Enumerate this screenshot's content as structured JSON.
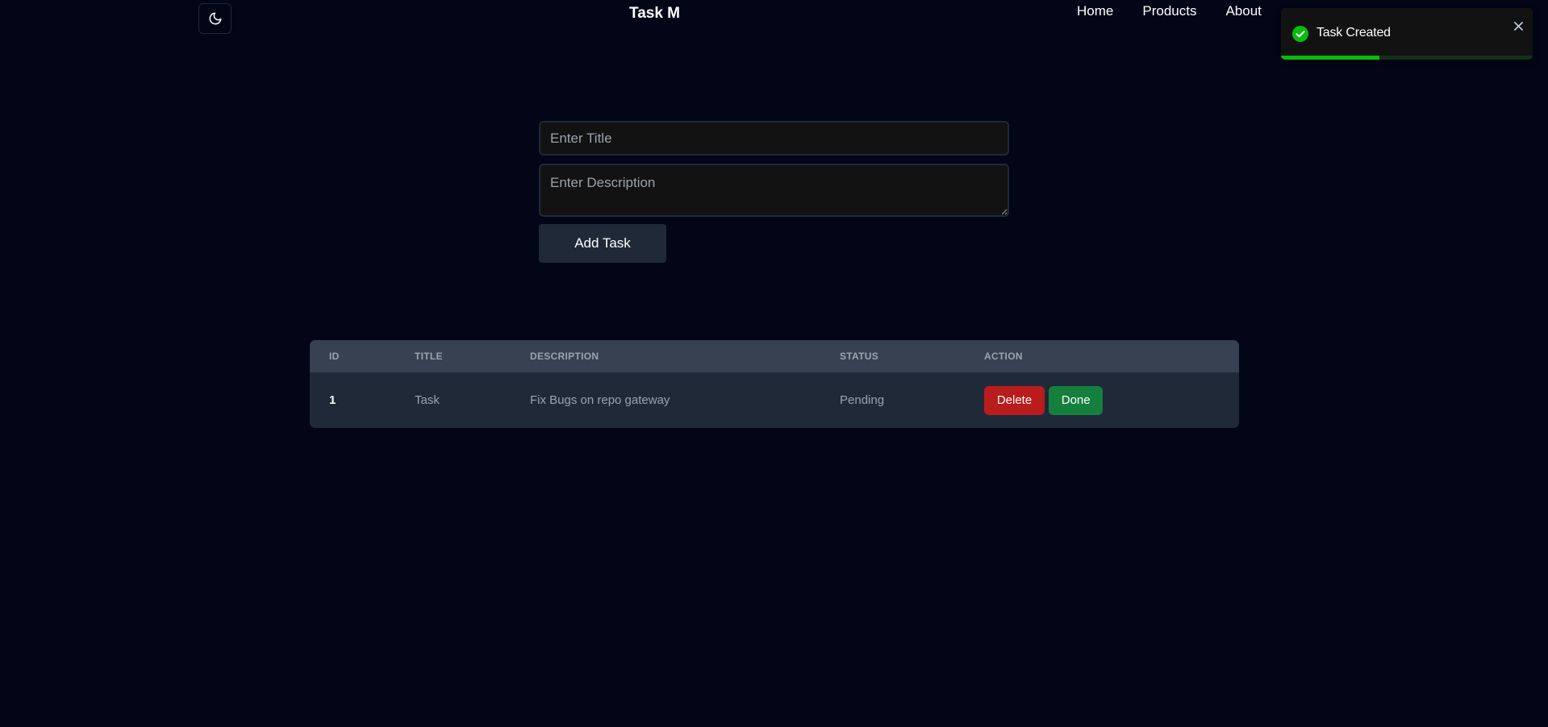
{
  "header": {
    "brand": "Task M",
    "nav": [
      {
        "label": "Home"
      },
      {
        "label": "Products"
      },
      {
        "label": "About"
      }
    ],
    "theme_icon": "moon-icon"
  },
  "toast": {
    "message": "Task Created",
    "icon": "check-circle-icon",
    "close_icon": "close-icon",
    "progress_fraction": 0.39,
    "colors": {
      "success": "#07bc0c",
      "background": "#121212"
    }
  },
  "form": {
    "title_placeholder": "Enter Title",
    "title_value": "",
    "description_placeholder": "Enter Description",
    "description_value": "",
    "submit_label": "Add Task"
  },
  "table": {
    "headers": [
      "ID",
      "TITLE",
      "DESCRIPTION",
      "STATUS",
      "ACTION"
    ],
    "rows": [
      {
        "id": "1",
        "title": "Task",
        "description": "Fix Bugs on repo gateway",
        "status": "Pending",
        "delete_label": "Delete",
        "done_label": "Done"
      }
    ]
  },
  "colors": {
    "background": "#020617",
    "delete": "#b91c1c",
    "done": "#15803d",
    "button": "#1f2937"
  }
}
